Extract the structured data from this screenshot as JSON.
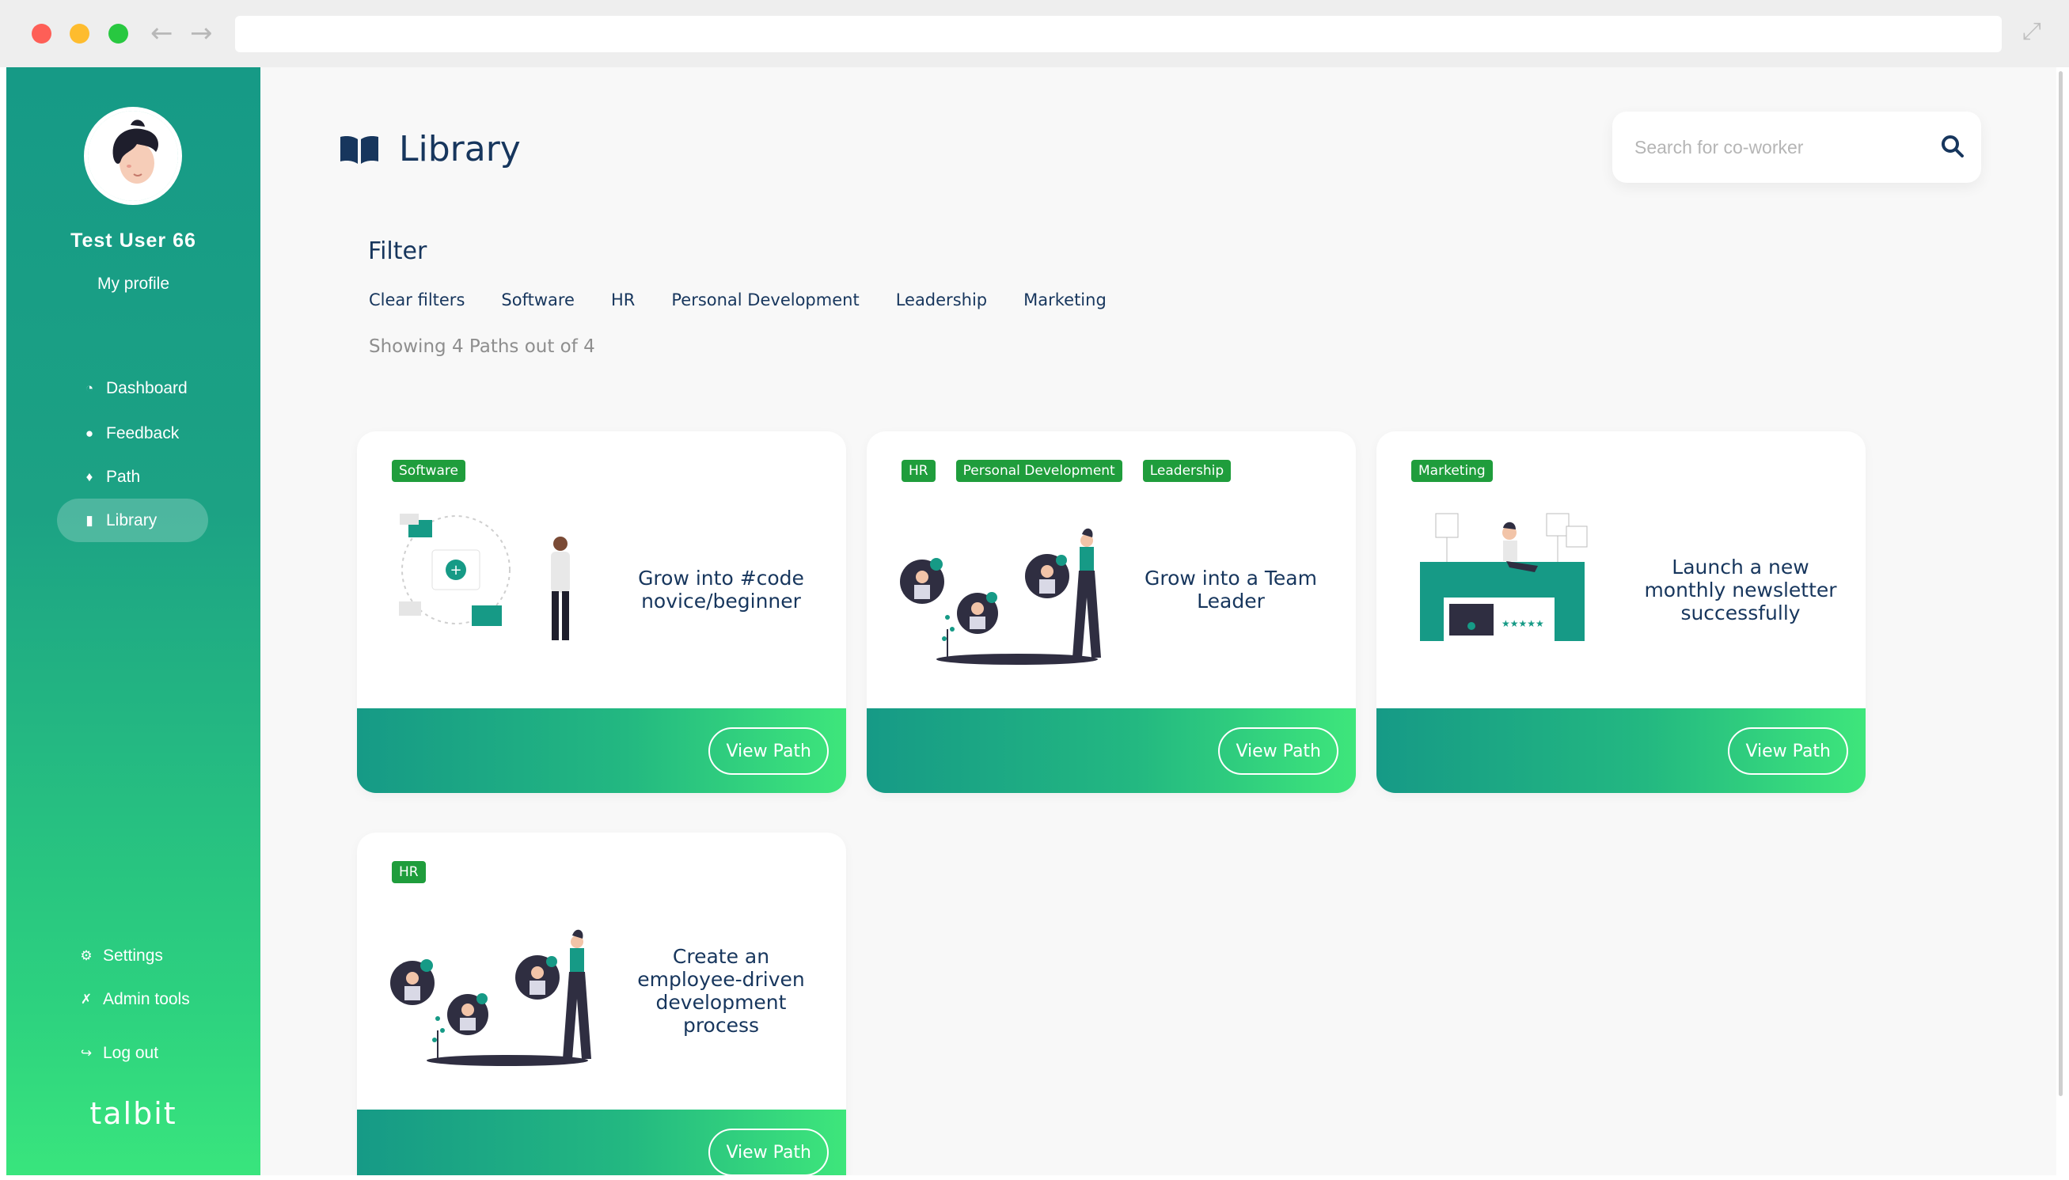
{
  "sidebar": {
    "user_name": "Test User 66",
    "profile_link": "My profile",
    "nav": [
      {
        "label": "Dashboard",
        "icon": "dashboard-icon"
      },
      {
        "label": "Feedback",
        "icon": "comment-icon"
      },
      {
        "label": "Path",
        "icon": "diamond-icon"
      },
      {
        "label": "Library",
        "icon": "book-icon",
        "active": true
      }
    ],
    "bottom_nav": [
      {
        "label": "Settings",
        "icon": "gear-icon"
      },
      {
        "label": "Admin tools",
        "icon": "tools-icon"
      },
      {
        "label": "Log out",
        "icon": "logout-icon"
      }
    ],
    "logo": "talbit"
  },
  "header": {
    "title": "Library",
    "search_placeholder": "Search for co-worker"
  },
  "filter": {
    "title": "Filter",
    "options": [
      "Clear filters",
      "Software",
      "HR",
      "Personal Development",
      "Leadership",
      "Marketing"
    ],
    "showing": "Showing 4 Paths out of 4"
  },
  "cards": [
    {
      "tags": [
        "Software"
      ],
      "title": "Grow into #code novice/beginner",
      "button": "View Path"
    },
    {
      "tags": [
        "HR",
        "Personal Development",
        "Leadership"
      ],
      "title": "Grow into a Team Leader",
      "button": "View Path"
    },
    {
      "tags": [
        "Marketing"
      ],
      "title": "Launch a new monthly newsletter successfully",
      "button": "View Path"
    },
    {
      "tags": [
        "HR"
      ],
      "title": "Create an employee-driven development process",
      "button": "View Path"
    }
  ],
  "colors": {
    "accent_start": "#169a86",
    "accent_end": "#3ee67b",
    "tag_green": "#1f9d3c",
    "navy": "#17365d"
  }
}
